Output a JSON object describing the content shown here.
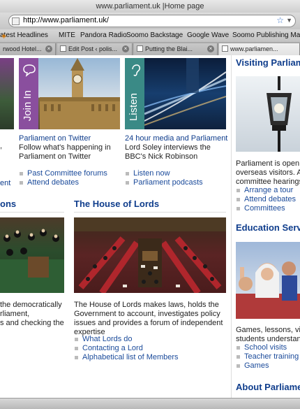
{
  "window": {
    "title": "www.parliament.uk |Home page"
  },
  "urlbar": {
    "url": "http://www.parliament.uk/"
  },
  "bookmarks": [
    "atest Headlines",
    "MITE",
    "Pandora Radio",
    "Soomo Backstage",
    "Google Wave",
    "Soomo Publishing Mail"
  ],
  "tabs": [
    {
      "label": "rwood Hotel...",
      "active": false
    },
    {
      "label": "Edit Post ‹ polis...",
      "active": false
    },
    {
      "label": "Putting the Blai...",
      "active": false
    },
    {
      "label": "www.parliamen...",
      "active": true
    }
  ],
  "promos": {
    "join": {
      "stripe_label": "Join In",
      "title": "Parliament on Twitter",
      "desc": "Follow what's happening in Parliament on Twitter"
    },
    "listen": {
      "stripe_label": "Listen",
      "title": "24 hour media and Parliament",
      "desc": "Lord Soley interviews the BBC's Nick Robinson"
    }
  },
  "partial_left": {
    "fragment_1": ",",
    "fragment_2": "ent"
  },
  "mid_links_left": [
    "Past Committee forums",
    "Attend debates"
  ],
  "mid_links_right": [
    "Listen now",
    "Parliament podcasts"
  ],
  "commons_section": {
    "heading_fragment": "ons",
    "desc_lines": [
      "the democratically",
      "rliament,",
      "s and checking the"
    ]
  },
  "lords_section": {
    "heading": "The House of Lords",
    "desc": "The House of Lords makes laws, holds the Government to account, investigates policy issues and provides a forum of independent expertise",
    "links": [
      "What Lords do",
      "Contacting a Lord",
      "Alphabetical list of Members"
    ]
  },
  "sidebar": {
    "visiting": {
      "heading": "Visiting Parliam",
      "desc_lines": [
        "Parliament is open t",
        "overseas visitors. A",
        "committee hearings"
      ],
      "links": [
        "Arrange a tour",
        "Attend debates",
        "Committees"
      ]
    },
    "education": {
      "heading": "Education Serv",
      "desc_lines": [
        "Games, lessons, vid",
        "students understand"
      ],
      "links": [
        "School visits",
        "Teacher training",
        "Games"
      ]
    },
    "about": {
      "heading": "About Parliame"
    }
  },
  "colors": {
    "link": "#0f3d8c",
    "join_stripe": "#8a4f9e",
    "listen_stripe": "#3a8a86"
  }
}
